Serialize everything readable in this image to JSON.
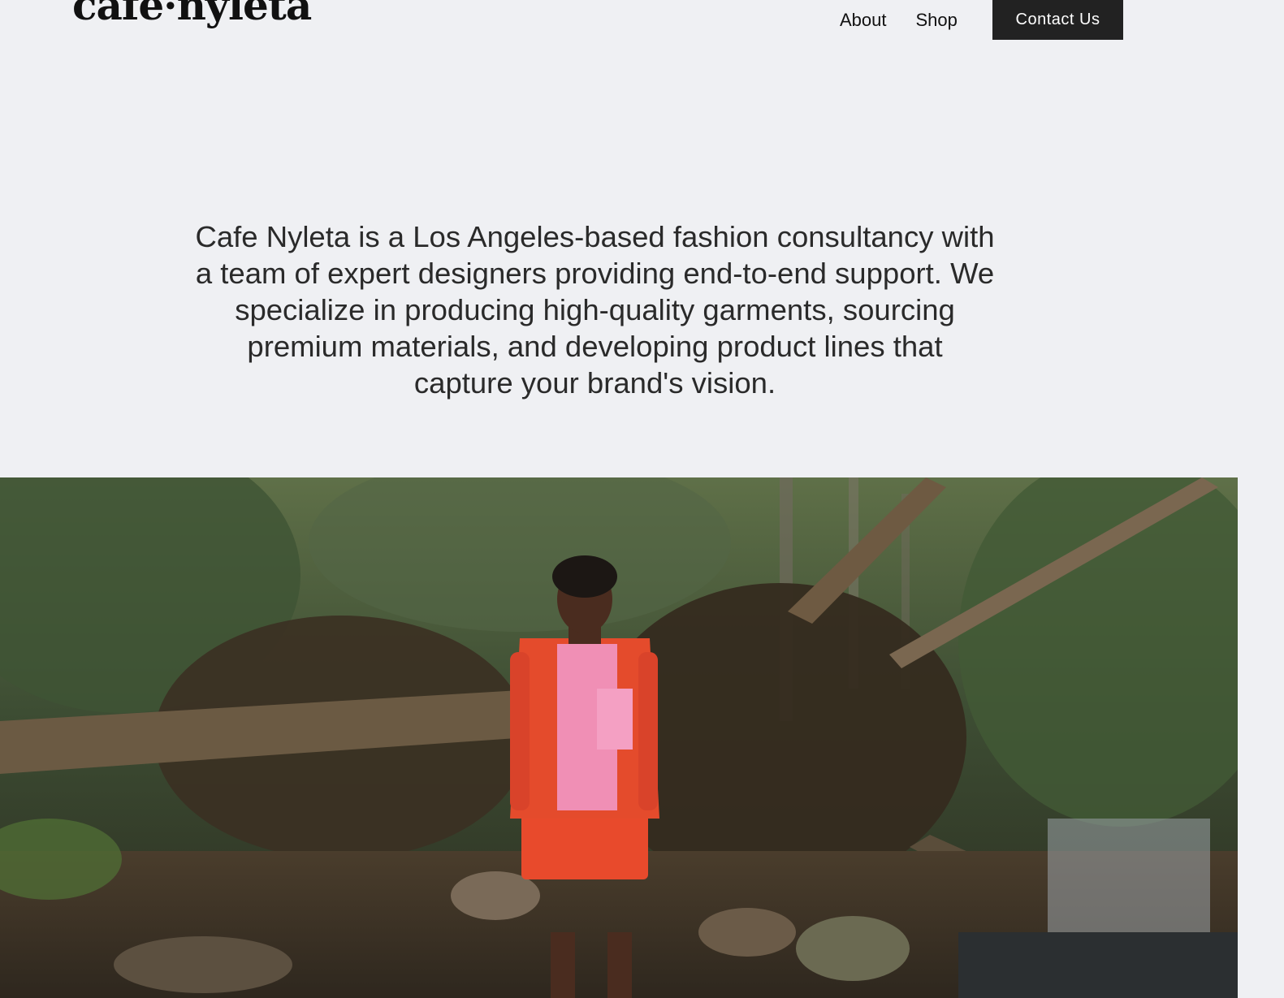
{
  "header": {
    "logo_text": "cafe·nyleta",
    "nav": {
      "about_label": "About",
      "shop_label": "Shop",
      "contact_label": "Contact Us"
    }
  },
  "intro": {
    "text": "Cafe Nyleta is a Los Angeles-based fashion consultancy with a team of expert designers providing end-to-end support. We specialize in producing high-quality garments, sourcing premium materials, and developing product lines that capture your brand's vision."
  },
  "hero": {
    "image_subject": "model in red jacket standing among fallen trees by a forest stream"
  },
  "colors": {
    "background": "#eff0f3",
    "button": "#222222",
    "button_text": "#ffffff",
    "text": "#2a2a2a"
  }
}
